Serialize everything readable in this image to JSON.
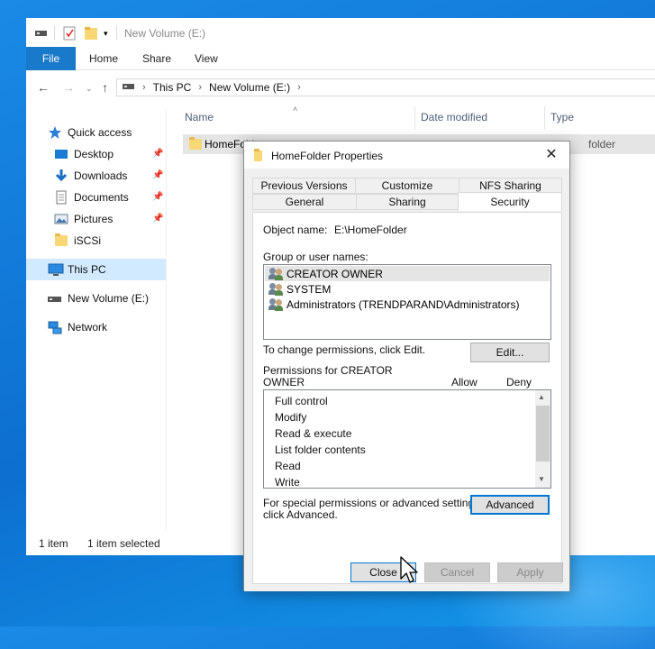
{
  "explorer": {
    "title": "New Volume (E:)",
    "ribbon": {
      "file": "File",
      "tabs": [
        "Home",
        "Share",
        "View"
      ]
    },
    "address": {
      "crumbs": [
        "This PC",
        "New Volume (E:)"
      ]
    },
    "nav_items": [
      {
        "label": "Quick access",
        "icon": "star-icon"
      },
      {
        "label": "Desktop",
        "icon": "desktop-icon",
        "pinned": true
      },
      {
        "label": "Downloads",
        "icon": "download-icon",
        "pinned": true
      },
      {
        "label": "Documents",
        "icon": "documents-icon",
        "pinned": true
      },
      {
        "label": "Pictures",
        "icon": "pictures-icon",
        "pinned": true
      },
      {
        "label": "iSCSi",
        "icon": "folder-icon"
      },
      {
        "label": "This PC",
        "icon": "pc-icon",
        "selected": true
      },
      {
        "label": "New Volume (E:)",
        "icon": "drive-icon"
      },
      {
        "label": "Network",
        "icon": "network-icon"
      }
    ],
    "columns": [
      "Name",
      "Date modified",
      "Type"
    ],
    "file": {
      "name": "HomeFolder",
      "type": "folder"
    },
    "status": {
      "count": "1 item",
      "selected": "1 item selected"
    }
  },
  "dialog": {
    "title": "HomeFolder Properties",
    "tabs_row1": [
      "Previous Versions",
      "Customize",
      "NFS Sharing"
    ],
    "tabs_row2": [
      "General",
      "Sharing",
      "Security"
    ],
    "object_label": "Object name:",
    "object_value": "E:\\HomeFolder",
    "group_label": "Group or user names:",
    "users": [
      "CREATOR OWNER",
      "SYSTEM",
      "Administrators (TRENDPARAND\\Administrators)"
    ],
    "change_hint": "To change permissions, click Edit.",
    "edit_button": "Edit...",
    "perm_label_1": "Permissions for CREATOR",
    "perm_label_2": "OWNER",
    "allow": "Allow",
    "deny": "Deny",
    "permissions": [
      "Full control",
      "Modify",
      "Read & execute",
      "List folder contents",
      "Read",
      "Write"
    ],
    "advanced_hint_1": "For special permissions or advanced settings,",
    "advanced_hint_2": "click Advanced.",
    "advanced_button": "Advanced",
    "buttons": {
      "close": "Close",
      "cancel": "Cancel",
      "apply": "Apply"
    }
  }
}
